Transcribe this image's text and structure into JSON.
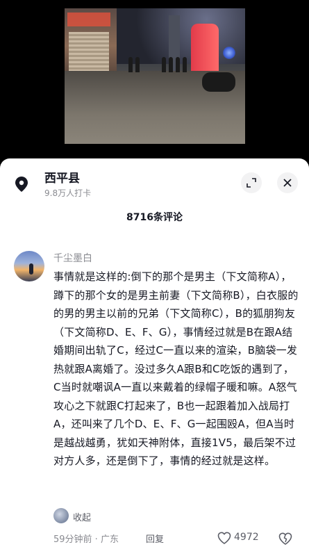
{
  "location": {
    "name": "西平县",
    "checkins": "9.8万人打卡"
  },
  "comments": {
    "count_label": "8716条评论"
  },
  "comment": {
    "username": "千尘墨白",
    "text": "事情就是这样的:倒下的那个是男主（下文简称A），蹲下的那个女的是男主前妻（下文简称B），白衣服的的男的男主以前的兄弟（下文简称C），B的狐朋狗友（下文简称D、E、F、G），事情经过就是B在跟A结婚期间出轨了C，经过C一直以来的渲染，B脑袋一发热就跟A离婚了。没过多久A跟B和C吃饭的遇到了，C当时就嘲讽A一直以来戴着的绿帽子暖和嘛。A怒气攻心之下就跟C打起来了，B也一起跟着加入战局打A，还叫来了几个D、E、F、G一起围殴A，但A当时是越战越勇，犹如天神附体，直接1V5，最后架不过对方人多，还是倒下了，事情的经过就是这样。",
    "collapse_label": "收起",
    "time": "59分钟前 · 广东",
    "reply_label": "回复",
    "likes": "4972"
  },
  "icons": {
    "location": "map-pin-icon",
    "expand": "expand-icon",
    "close": "close-icon",
    "like": "heart-icon",
    "dislike": "broken-heart-icon"
  }
}
